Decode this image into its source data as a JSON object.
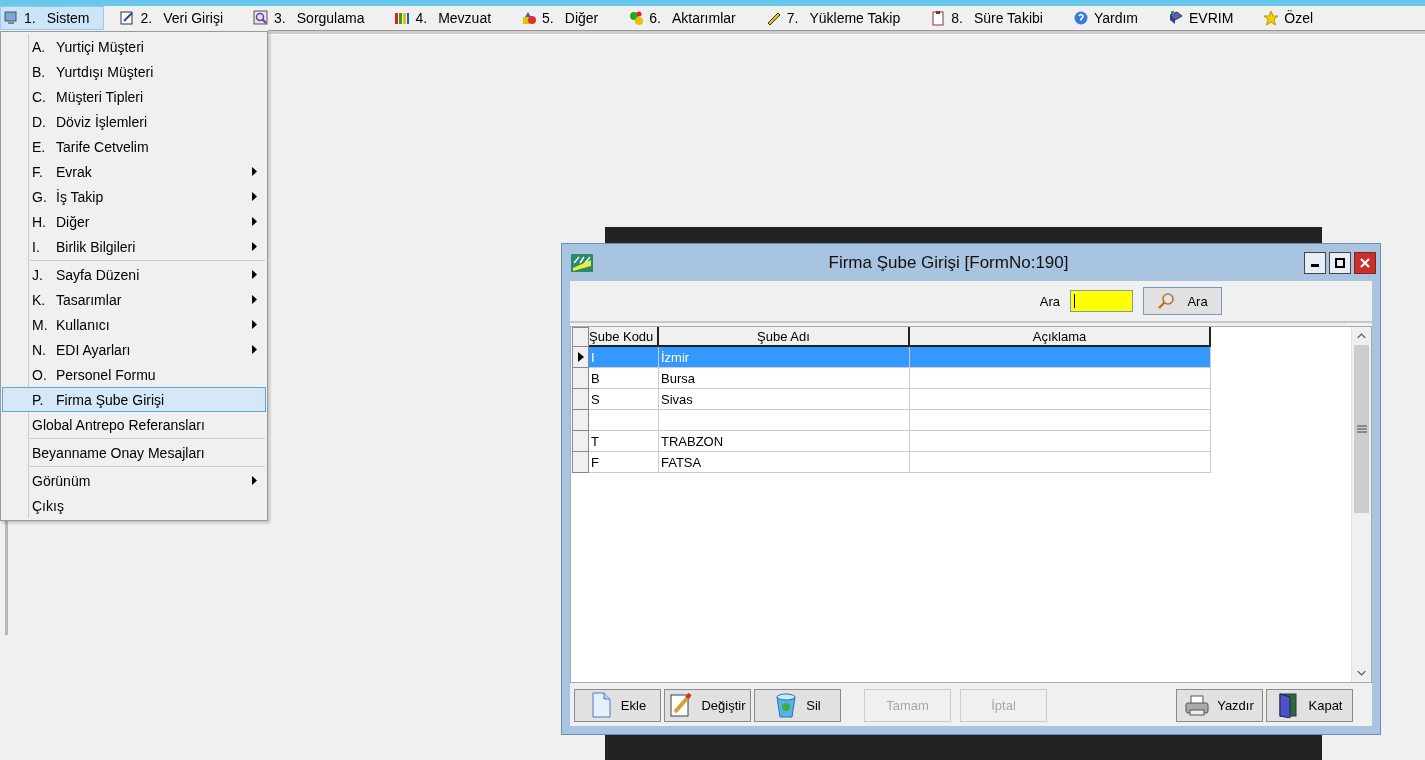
{
  "menubar": {
    "items": [
      {
        "key": "1.",
        "label": "Sistem",
        "selected": true
      },
      {
        "key": "2.",
        "label": "Veri Girişi",
        "selected": false
      },
      {
        "key": "3.",
        "label": "Sorgulama",
        "selected": false
      },
      {
        "key": "4.",
        "label": "Mevzuat",
        "selected": false
      },
      {
        "key": "5.",
        "label": "Diğer",
        "selected": false
      },
      {
        "key": "6.",
        "label": "Aktarımlar",
        "selected": false
      },
      {
        "key": "7.",
        "label": "Yükleme Takip",
        "selected": false
      },
      {
        "key": "8.",
        "label": "Süre Takibi",
        "selected": false
      },
      {
        "label": "Yardım",
        "selected": false
      },
      {
        "label": "EVRIM",
        "selected": false
      },
      {
        "label": "Özel",
        "selected": false
      }
    ]
  },
  "dropdown": {
    "items": [
      {
        "kind": "item",
        "key": "A.",
        "label": "Yurtiçi Müşteri",
        "submenu": false,
        "selected": false
      },
      {
        "kind": "item",
        "key": "B.",
        "label": "Yurtdışı Müşteri",
        "submenu": false,
        "selected": false
      },
      {
        "kind": "item",
        "key": "C.",
        "label": "Müşteri Tipleri",
        "submenu": false,
        "selected": false
      },
      {
        "kind": "item",
        "key": "D.",
        "label": "Döviz İşlemleri",
        "submenu": false,
        "selected": false
      },
      {
        "kind": "item",
        "key": "E.",
        "label": "Tarife Cetvelim",
        "submenu": false,
        "selected": false
      },
      {
        "kind": "item",
        "key": "F.",
        "label": "Evrak",
        "submenu": true,
        "selected": false
      },
      {
        "kind": "item",
        "key": "G.",
        "label": "İş Takip",
        "submenu": true,
        "selected": false
      },
      {
        "kind": "item",
        "key": "H.",
        "label": "Diğer",
        "submenu": true,
        "selected": false
      },
      {
        "kind": "item",
        "key": "I.",
        "label": "Birlik Bilgileri",
        "submenu": true,
        "selected": false
      },
      {
        "kind": "separator"
      },
      {
        "kind": "item",
        "key": "J.",
        "label": "Sayfa Düzeni",
        "submenu": true,
        "selected": false
      },
      {
        "kind": "item",
        "key": "K.",
        "label": "Tasarımlar",
        "submenu": true,
        "selected": false
      },
      {
        "kind": "item",
        "key": "M.",
        "label": "Kullanıcı",
        "submenu": true,
        "selected": false
      },
      {
        "kind": "item",
        "key": "N.",
        "label": "EDI Ayarları",
        "submenu": true,
        "selected": false
      },
      {
        "kind": "item",
        "key": "O.",
        "label": "Personel Formu",
        "submenu": false,
        "selected": false
      },
      {
        "kind": "item",
        "key": "P.",
        "label": "Firma Şube Girişi",
        "submenu": false,
        "selected": true
      },
      {
        "kind": "item",
        "label": "Global Antrepo Referansları",
        "submenu": false,
        "selected": false
      },
      {
        "kind": "separator"
      },
      {
        "kind": "item",
        "label": "Beyanname Onay Mesajları",
        "submenu": false,
        "selected": false
      },
      {
        "kind": "separator"
      },
      {
        "kind": "item",
        "label": "Görünüm",
        "submenu": true,
        "selected": false
      },
      {
        "kind": "item",
        "label": "Çıkış",
        "submenu": false,
        "selected": false
      }
    ]
  },
  "dialog": {
    "title": "Firma Şube Girişi [FormNo:190]",
    "search": {
      "label": "Ara",
      "button": "Ara"
    },
    "table": {
      "columns": [
        "Şube Kodu",
        "Şube Adı",
        "Açıklama"
      ],
      "rows": [
        {
          "cells": [
            "I",
            "İzmir",
            ""
          ],
          "selected": true
        },
        {
          "cells": [
            "B",
            "Bursa",
            ""
          ],
          "selected": false
        },
        {
          "cells": [
            "S",
            "Sivas",
            ""
          ],
          "selected": false
        },
        {
          "cells": [
            "",
            "",
            ""
          ],
          "selected": false
        },
        {
          "cells": [
            "T",
            "TRABZON",
            ""
          ],
          "selected": false
        },
        {
          "cells": [
            "F",
            "FATSA",
            ""
          ],
          "selected": false
        }
      ]
    },
    "buttons": [
      {
        "label": "Ekle",
        "disabled": false
      },
      {
        "label": "Değiştir",
        "disabled": false
      },
      {
        "label": "Sil",
        "disabled": false
      },
      {
        "label": "Tamam",
        "disabled": true
      },
      {
        "label": "İptal",
        "disabled": true
      },
      {
        "label": "Yazdır",
        "disabled": false
      },
      {
        "label": "Kapat",
        "disabled": false
      }
    ]
  }
}
